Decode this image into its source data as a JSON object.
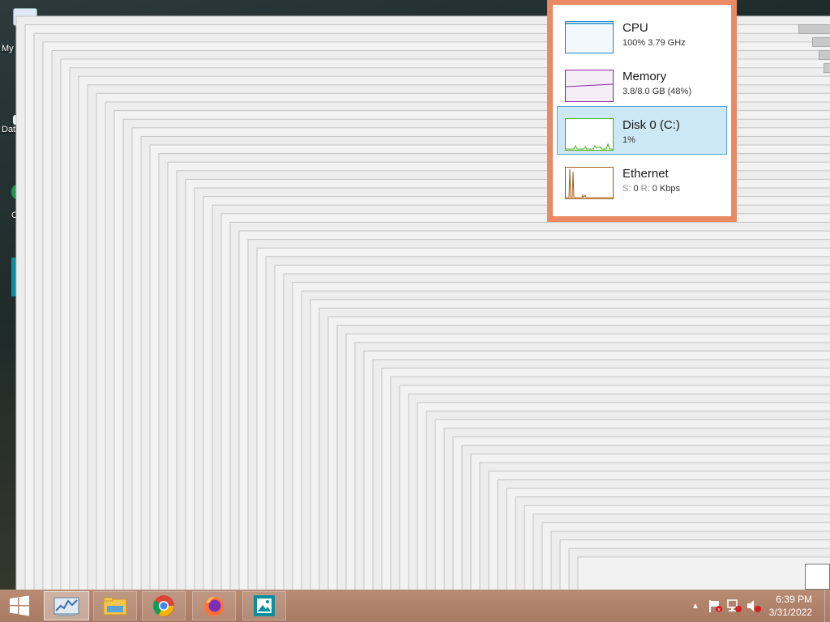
{
  "desktop": {
    "icons": [
      {
        "label": "My",
        "icon": "computer-icon"
      },
      {
        "label": "Dat",
        "icon": "data-icon"
      },
      {
        "label": "C",
        "icon": "app-icon"
      }
    ]
  },
  "task_manager": {
    "items": [
      {
        "name": "CPU",
        "detail": "100%  3.79 GHz",
        "color": "#1e87c8",
        "selected": false
      },
      {
        "name": "Memory",
        "detail": "3.8/8.0 GB (48%)",
        "color": "#8b2a9c",
        "selected": false
      },
      {
        "name": "Disk 0 (C:)",
        "detail": "1%",
        "color": "#4caf24",
        "selected": true
      },
      {
        "name": "Ethernet",
        "detail_label_s": "S:",
        "detail_s": "0",
        "detail_label_r": "R:",
        "detail_r": "0 Kbps",
        "color": "#a9601b",
        "selected": false
      }
    ]
  },
  "taskbar": {
    "start_icon": "windows-logo-icon",
    "apps": [
      {
        "name": "task-manager",
        "icon": "performance-graph-icon",
        "state": "active"
      },
      {
        "name": "file-explorer",
        "icon": "folder-icon",
        "state": "pinned"
      },
      {
        "name": "chrome",
        "icon": "chrome-icon",
        "state": "pinned"
      },
      {
        "name": "firefox",
        "icon": "firefox-icon",
        "state": "pinned"
      },
      {
        "name": "photos",
        "icon": "image-viewer-icon",
        "state": "pinned"
      }
    ],
    "tray": {
      "icons": [
        "show-hidden-icons-chevron",
        "action-center-flag-icon",
        "network-icon",
        "volume-muted-icon"
      ]
    },
    "clock": {
      "time": "6:39 PM",
      "date": "3/31/2022"
    }
  }
}
